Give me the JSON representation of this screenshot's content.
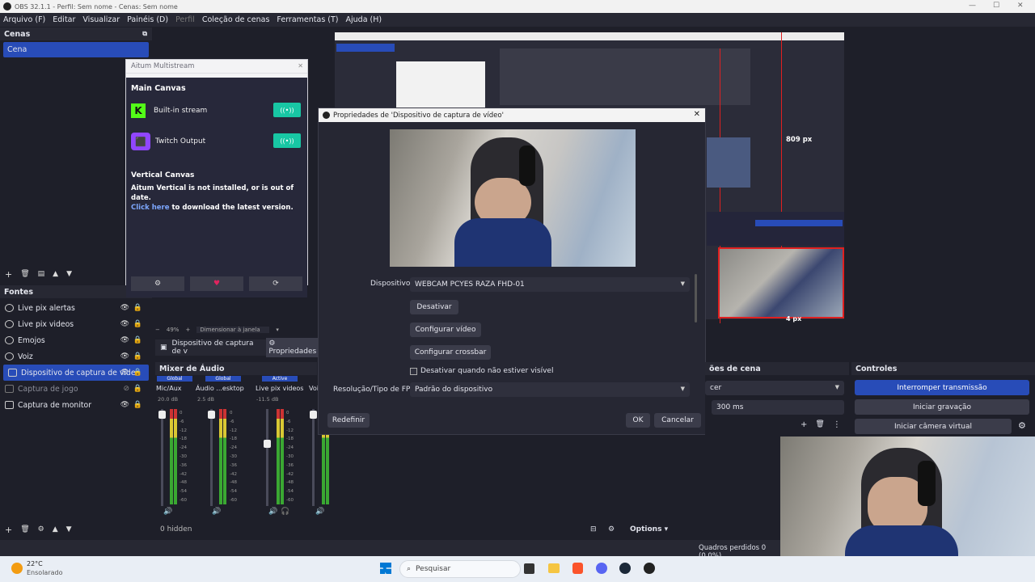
{
  "window": {
    "title": "OBS 32.1.1 - Perfil: Sem nome - Cenas: Sem nome"
  },
  "menu": [
    "Arquivo (F)",
    "Editar",
    "Visualizar",
    "Painéis (D)",
    "Perfil",
    "Coleção de cenas",
    "Ferramentas (T)",
    "Ajuda (H)"
  ],
  "scenes": {
    "header": "Cenas",
    "items": [
      "Cena"
    ]
  },
  "multistream": {
    "title": "Aitum Multistream",
    "main_canvas": "Main Canvas",
    "outputs": [
      {
        "name": "Built-in stream"
      },
      {
        "name": "Twitch Output"
      }
    ],
    "vertical_title": "Vertical Canvas",
    "vertical_msg": "Aitum Vertical is not installed, or is out of date.",
    "link": "Click here",
    "vertical_msg2": "to download the latest version."
  },
  "sources": {
    "header": "Fontes",
    "items": [
      {
        "name": "Live pix alertas",
        "icon": "browser-icon"
      },
      {
        "name": "Live pix videos",
        "icon": "browser-icon"
      },
      {
        "name": "Emojos",
        "icon": "browser-icon"
      },
      {
        "name": "Voiz",
        "icon": "browser-icon"
      },
      {
        "name": "Dispositivo de captura de vídeo",
        "icon": "camera-icon"
      },
      {
        "name": "Captura de jogo",
        "icon": "gamepad-icon"
      },
      {
        "name": "Captura de monitor",
        "icon": "monitor-icon"
      }
    ]
  },
  "preview_toolbar": {
    "zoom": "49%",
    "fit": "Dimensionar à janela",
    "source": "Dispositivo de captura de v",
    "props": "Propriedades"
  },
  "mixer": {
    "header": "Mixer de Áudio",
    "channels": [
      {
        "name": "Mic/Aux",
        "tag": "Global",
        "db": "20.0 dB"
      },
      {
        "name": "Áudio ...esktop",
        "tag": "Global",
        "db": "2.5 dB"
      },
      {
        "name": "Live pix videos",
        "tag": "Active",
        "db": "-11.5 dB"
      },
      {
        "name": "Voi",
        "tag": "",
        "db": ""
      }
    ],
    "scale": [
      "0",
      "-6",
      "-12",
      "-18",
      "-24",
      "-30",
      "-36",
      "-42",
      "-48",
      "-54",
      "-60"
    ],
    "hidden": "0 hidden",
    "options": "Options"
  },
  "dialog": {
    "title": "Propriedades de 'Dispositivo de captura de vídeo'",
    "device_label": "Dispositivo",
    "device_value": "WEBCAM PCYES RAZA FHD-01",
    "btn_disable": "Desativar",
    "btn_config_video": "Configurar vídeo",
    "btn_crossbar": "Configurar crossbar",
    "checkbox_label": "Desativar quando não estiver visível",
    "fps_label": "Resolução/Tipo de FPS",
    "fps_value": "Padrão do dispositivo",
    "btn_reset": "Redefinir",
    "btn_ok": "OK",
    "btn_cancel": "Cancelar"
  },
  "preview": {
    "measure1": "809 px",
    "measure2": "4 px"
  },
  "transitions": {
    "header": "ões de cena",
    "combo": "cer",
    "duration": "300 ms"
  },
  "controls": {
    "header": "Controles",
    "buttons": [
      "Interromper transmissão",
      "Iniciar gravação",
      "Iniciar câmera virtual"
    ]
  },
  "status": {
    "dropped": "Quadros perdidos 0 (0.0%)"
  },
  "taskbar": {
    "temp": "22°C",
    "weather": "Ensolarado",
    "search": "Pesquisar"
  },
  "colors": {
    "accent": "#284cb8",
    "active_green": "#18c7a4",
    "selection_red": "#e02020"
  }
}
